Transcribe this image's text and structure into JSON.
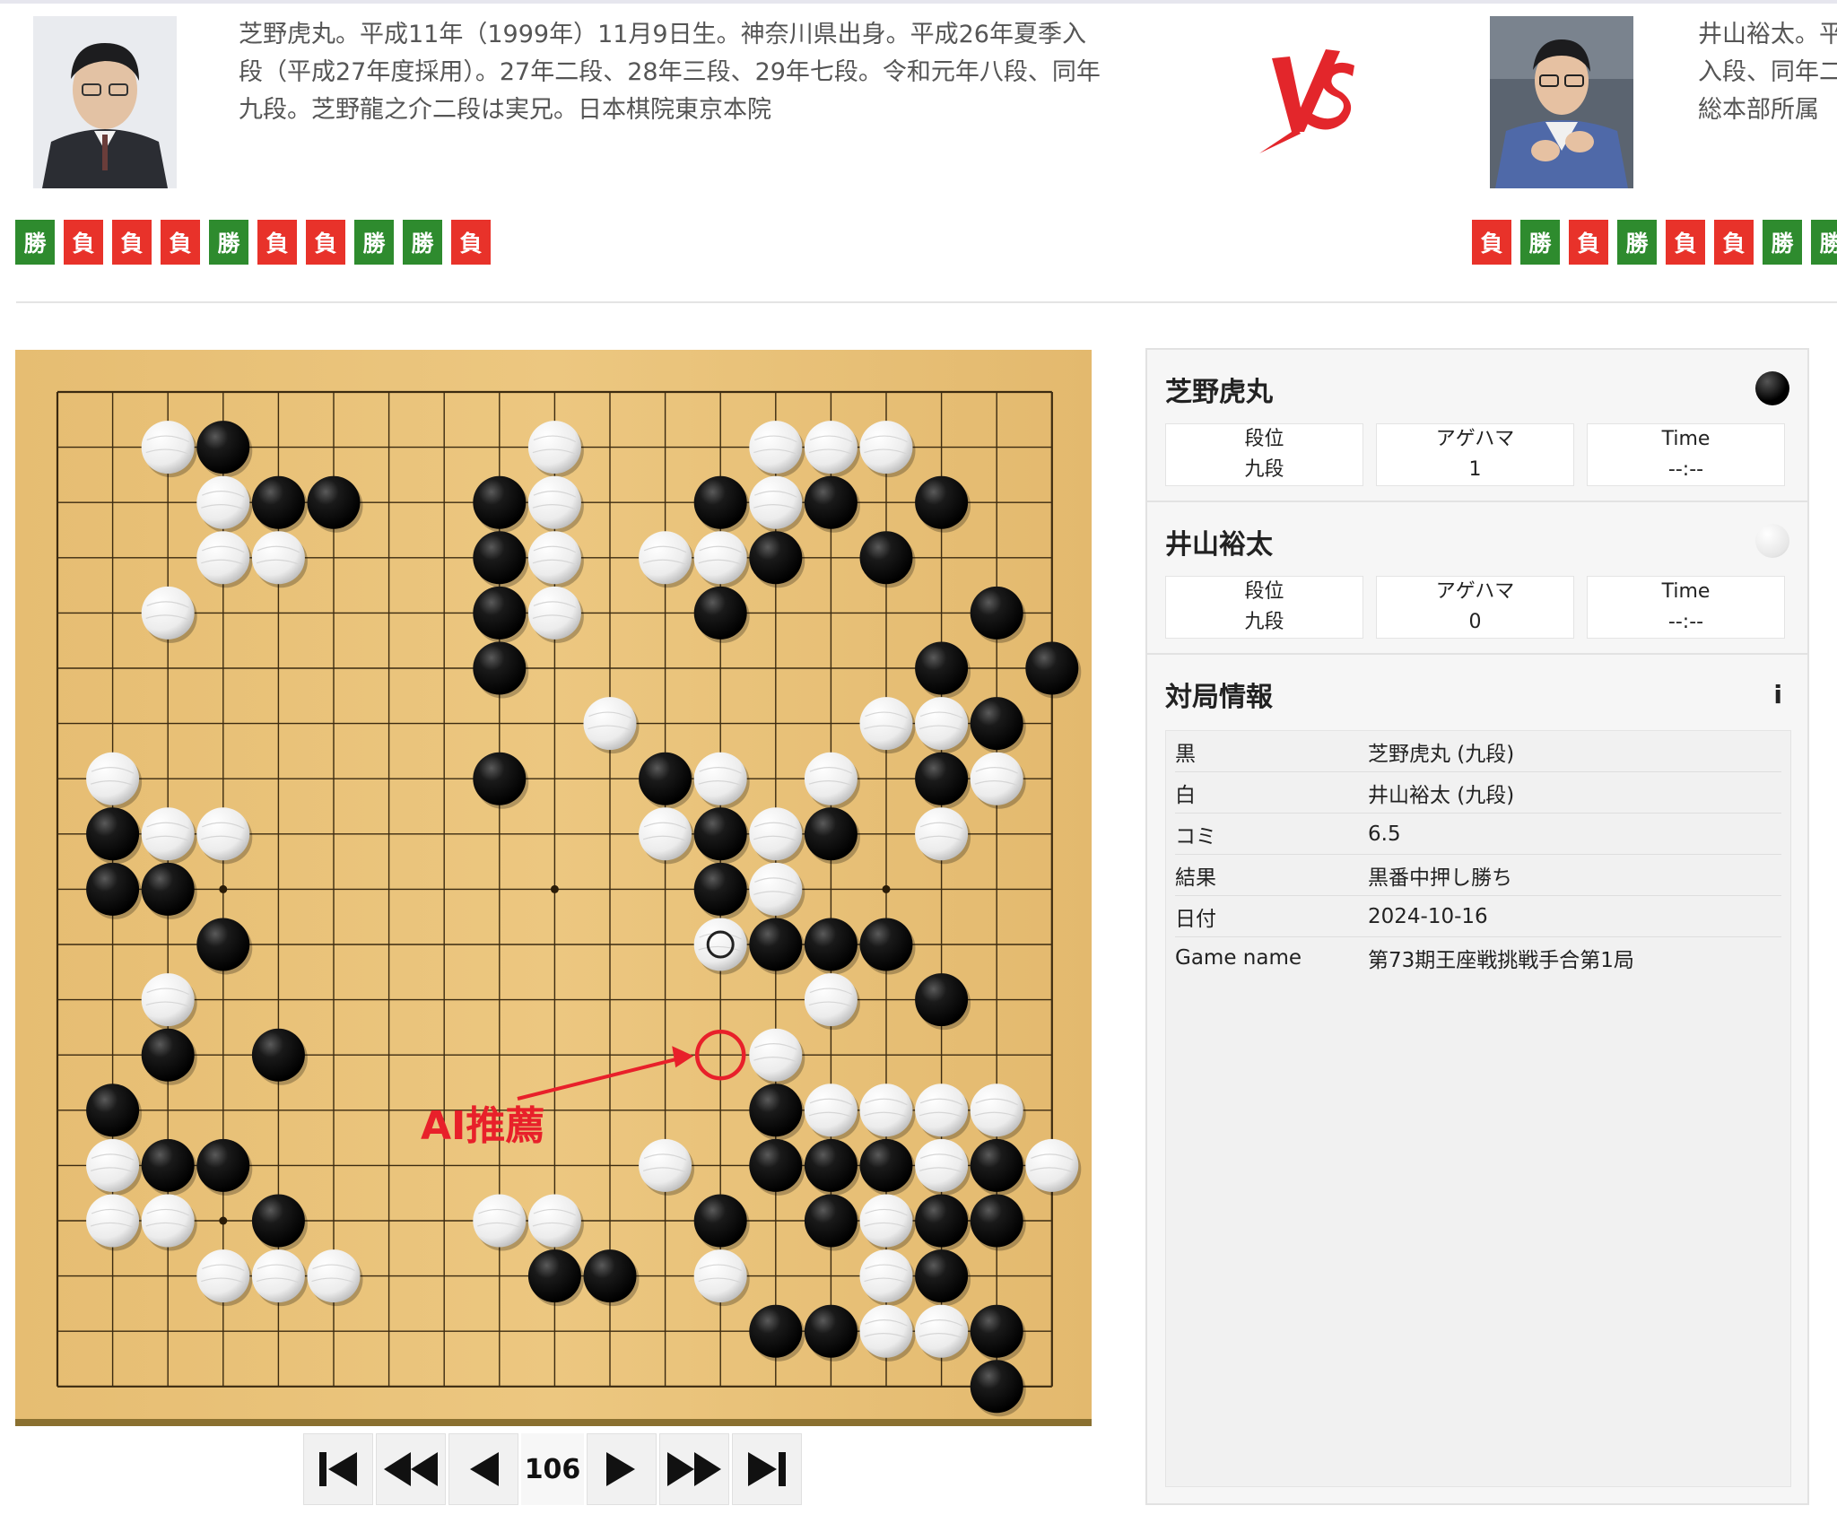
{
  "player_left": {
    "bio": [
      "芝野虎丸。平成11年（1999年）11月9日生。神奈川県出身。平成26年夏季入",
      "段（平成27年度採用）。27年二段、28年三段、29年七段。令和元年八段、同年",
      "九段。芝野龍之介二段は実兄。日本棋院東京本院"
    ],
    "record": [
      "勝",
      "負",
      "負",
      "負",
      "勝",
      "負",
      "負",
      "勝",
      "勝",
      "負"
    ]
  },
  "player_right": {
    "bio": [
      "井山裕太。平",
      "入段、同年二",
      "総本部所属"
    ],
    "record": [
      "負",
      "勝",
      "負",
      "勝",
      "負",
      "負",
      "勝",
      "勝"
    ]
  },
  "vs_label": "VS",
  "colors": {
    "win": "#2e8b2e",
    "loss": "#e8322a",
    "board": "#e8c177",
    "annotation": "#e8202a"
  },
  "board": {
    "size": 19,
    "black": [
      [
        3,
        1
      ],
      [
        4,
        2
      ],
      [
        5,
        2
      ],
      [
        12,
        2
      ],
      [
        14,
        2
      ],
      [
        16,
        2
      ],
      [
        8,
        2
      ],
      [
        8,
        3
      ],
      [
        13,
        3
      ],
      [
        15,
        3
      ],
      [
        8,
        4
      ],
      [
        12,
        4
      ],
      [
        17,
        4
      ],
      [
        8,
        5
      ],
      [
        16,
        5
      ],
      [
        18,
        5
      ],
      [
        17,
        6
      ],
      [
        8,
        7
      ],
      [
        11,
        7
      ],
      [
        16,
        7
      ],
      [
        1,
        8
      ],
      [
        12,
        8
      ],
      [
        14,
        8
      ],
      [
        1,
        9
      ],
      [
        2,
        9
      ],
      [
        12,
        9
      ],
      [
        3,
        10
      ],
      [
        13,
        10
      ],
      [
        14,
        10
      ],
      [
        15,
        10
      ],
      [
        16,
        11
      ],
      [
        2,
        12
      ],
      [
        4,
        12
      ],
      [
        1,
        13
      ],
      [
        13,
        13
      ],
      [
        2,
        14
      ],
      [
        3,
        14
      ],
      [
        13,
        14
      ],
      [
        14,
        14
      ],
      [
        15,
        14
      ],
      [
        17,
        14
      ],
      [
        4,
        15
      ],
      [
        12,
        15
      ],
      [
        14,
        15
      ],
      [
        16,
        15
      ],
      [
        17,
        15
      ],
      [
        9,
        16
      ],
      [
        10,
        16
      ],
      [
        16,
        16
      ],
      [
        13,
        17
      ],
      [
        14,
        17
      ],
      [
        17,
        17
      ],
      [
        17,
        18
      ]
    ],
    "white": [
      [
        2,
        1
      ],
      [
        9,
        1
      ],
      [
        13,
        1
      ],
      [
        14,
        1
      ],
      [
        15,
        1
      ],
      [
        3,
        2
      ],
      [
        9,
        2
      ],
      [
        13,
        2
      ],
      [
        3,
        3
      ],
      [
        4,
        3
      ],
      [
        9,
        3
      ],
      [
        11,
        3
      ],
      [
        12,
        3
      ],
      [
        2,
        4
      ],
      [
        9,
        4
      ],
      [
        10,
        6
      ],
      [
        15,
        6
      ],
      [
        16,
        6
      ],
      [
        1,
        7
      ],
      [
        12,
        7
      ],
      [
        14,
        7
      ],
      [
        17,
        7
      ],
      [
        2,
        8
      ],
      [
        3,
        8
      ],
      [
        11,
        8
      ],
      [
        13,
        8
      ],
      [
        16,
        8
      ],
      [
        13,
        9
      ],
      [
        12,
        10
      ],
      [
        2,
        11
      ],
      [
        14,
        11
      ],
      [
        13,
        12
      ],
      [
        14,
        13
      ],
      [
        15,
        13
      ],
      [
        16,
        13
      ],
      [
        17,
        13
      ],
      [
        1,
        14
      ],
      [
        11,
        14
      ],
      [
        16,
        14
      ],
      [
        18,
        14
      ],
      [
        1,
        15
      ],
      [
        2,
        15
      ],
      [
        8,
        15
      ],
      [
        9,
        15
      ],
      [
        15,
        15
      ],
      [
        3,
        16
      ],
      [
        4,
        16
      ],
      [
        5,
        16
      ],
      [
        12,
        16
      ],
      [
        15,
        16
      ],
      [
        15,
        17
      ],
      [
        16,
        17
      ]
    ],
    "last_move": [
      12,
      10
    ],
    "ai_recommend": [
      12,
      12
    ],
    "ai_label": "AI推薦"
  },
  "nav": {
    "move_number": "106"
  },
  "panel": {
    "black_player": {
      "name": "芝野虎丸",
      "rank_label": "段位",
      "rank": "九段",
      "captures_label": "アゲハマ",
      "captures": "1",
      "time_label": "Time",
      "time": "--:--"
    },
    "white_player": {
      "name": "井山裕太",
      "rank_label": "段位",
      "rank": "九段",
      "captures_label": "アゲハマ",
      "captures": "0",
      "time_label": "Time",
      "time": "--:--"
    },
    "info_title": "対局情報",
    "info_icon": "i",
    "info_rows": [
      {
        "k": "黒",
        "v": "芝野虎丸 (九段)"
      },
      {
        "k": "白",
        "v": "井山裕太 (九段)"
      },
      {
        "k": "コミ",
        "v": "6.5"
      },
      {
        "k": "結果",
        "v": "黒番中押し勝ち"
      },
      {
        "k": "日付",
        "v": "2024-10-16"
      },
      {
        "k": "Game name",
        "v": "第73期王座戦挑戦手合第1局"
      }
    ]
  }
}
